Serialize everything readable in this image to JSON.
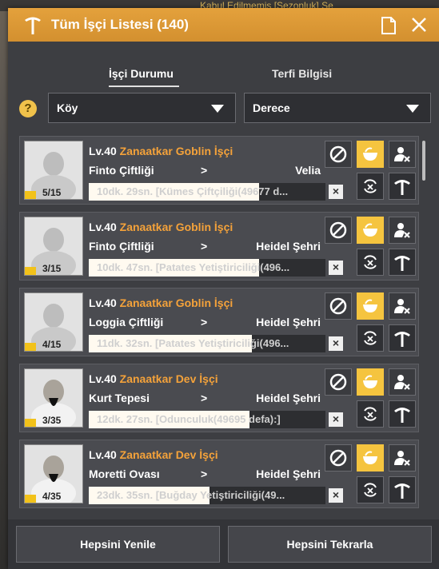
{
  "background": {
    "top_text": "Kabul Edilmemiş [Sezonluk] Se"
  },
  "window": {
    "title": "Tüm İşçi Listesi (140)"
  },
  "tabs": [
    {
      "label": "İşçi Durumu",
      "active": true
    },
    {
      "label": "Terfi Bilgisi",
      "active": false
    }
  ],
  "filters": {
    "help": "?",
    "village": "Köy",
    "grade": "Derece"
  },
  "workers": [
    {
      "level": "Lv.40",
      "type": "Zanaatkar Goblin İşçi",
      "from": "Finto Çiftliği",
      "arrow": ">",
      "to": "Velia",
      "task": "10dk. 29sn. [Kümes Çiftçiliği(49677 d...",
      "progress": 0.72,
      "count": "5/15",
      "portrait": "goblin"
    },
    {
      "level": "Lv.40",
      "type": "Zanaatkar Goblin İşçi",
      "from": "Finto Çiftliği",
      "arrow": ">",
      "to": "Heidel Şehri",
      "task": "10dk. 47sn. [Patates Yetiştiriciliği(496...",
      "progress": 0.72,
      "count": "3/15",
      "portrait": "goblin"
    },
    {
      "level": "Lv.40",
      "type": "Zanaatkar Goblin İşçi",
      "from": "Loggia Çiftliği",
      "arrow": ">",
      "to": "Heidel Şehri",
      "task": "11dk. 32sn. [Patates Yetiştiriciliği(496...",
      "progress": 0.69,
      "count": "4/15",
      "portrait": "goblin"
    },
    {
      "level": "Lv.40",
      "type": "Zanaatkar Dev İşçi",
      "from": "Kurt Tepesi",
      "arrow": ">",
      "to": "Heidel Şehri",
      "task": "12dk. 27sn. [Odunculuk(49695 defa):]",
      "progress": 0.68,
      "count": "3/35",
      "portrait": "giant"
    },
    {
      "level": "Lv.40",
      "type": "Zanaatkar Dev İşçi",
      "from": "Moretti Ovası",
      "arrow": ">",
      "to": "Heidel Şehri",
      "task": "23dk. 35sn. [Buğday Yetiştiriciliği(49...",
      "progress": 0.51,
      "count": "4/35",
      "portrait": "giant"
    }
  ],
  "footer": {
    "refresh_all": "Hepsini Yenile",
    "repeat_all": "Hepsini Tekrarla"
  },
  "colors": {
    "title_bar": "#e4a13c",
    "worker_type": "#f4a23a",
    "action_gold": "#f5c43f"
  },
  "icons": [
    "worker-pickaxe-icon",
    "document-icon",
    "close-icon",
    "cancel-circle-icon",
    "food-bowl-icon",
    "dismiss-worker-icon",
    "repeat-icon",
    "pickaxe-icon"
  ]
}
